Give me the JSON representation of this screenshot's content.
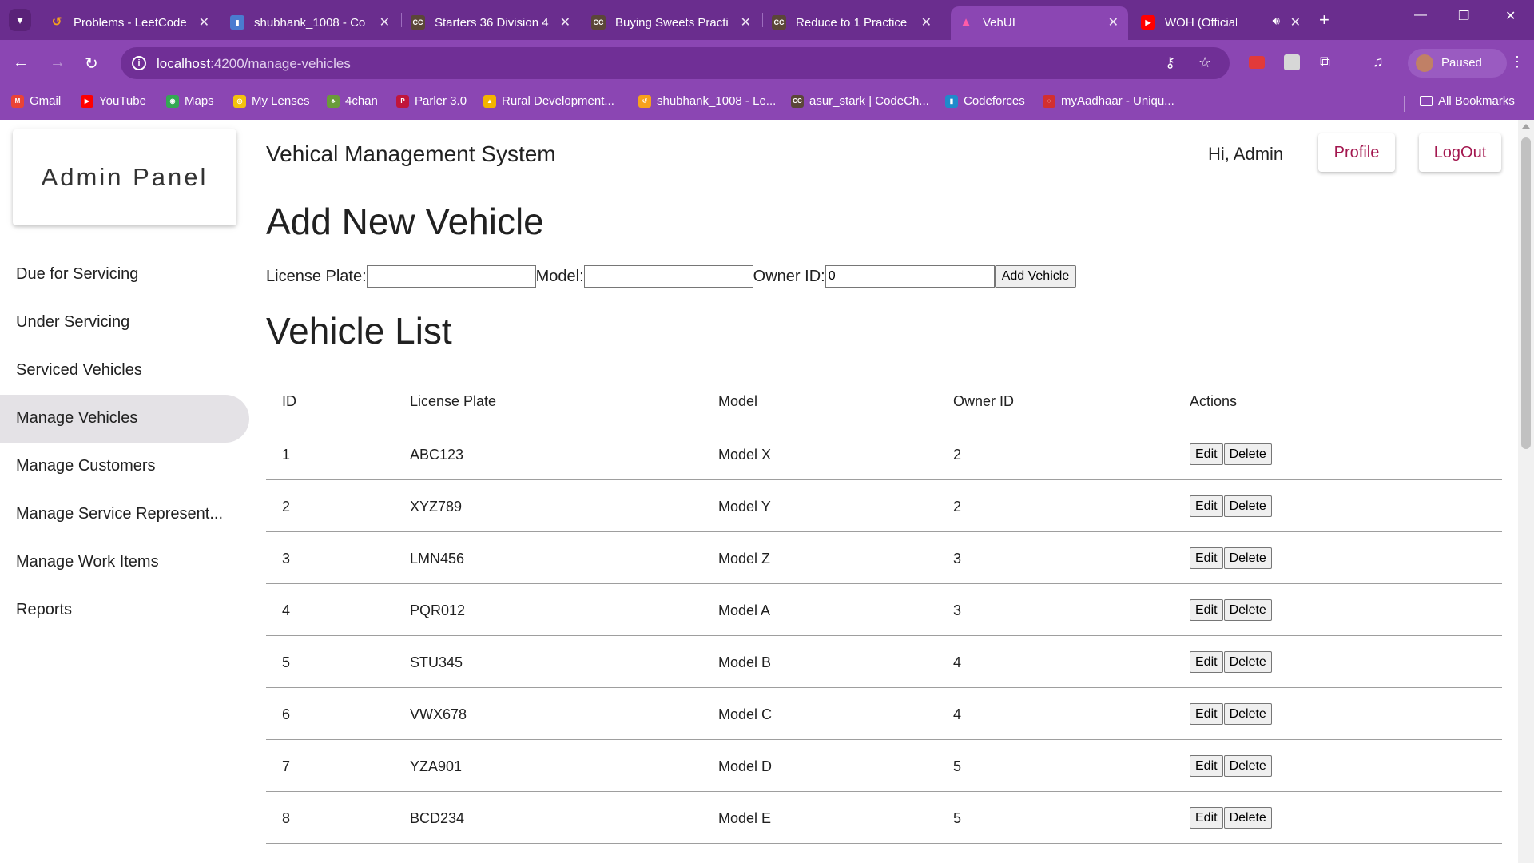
{
  "browser": {
    "tabs": [
      {
        "title": "Problems - LeetCode",
        "favicon": "leetcode-icon",
        "color": "#f7a21b"
      },
      {
        "title": "shubhank_1008 - Co",
        "favicon": "chart-icon",
        "color": "#4a7bd0"
      },
      {
        "title": "Starters 36 Division 4",
        "favicon": "codechef-icon",
        "color": "#5b4638"
      },
      {
        "title": "Buying Sweets Practi",
        "favicon": "codechef-icon",
        "color": "#5b4638"
      },
      {
        "title": "Reduce to 1 Practice",
        "favicon": "codechef-icon",
        "color": "#5b4638"
      },
      {
        "title": "VehUI",
        "favicon": "angular-icon",
        "color": "#d6247a"
      },
      {
        "title": "WOH (Official Vi",
        "favicon": "youtube-icon",
        "color": "#ff0000"
      }
    ],
    "address": {
      "host": "localhost",
      "path": ":4200/manage-vehicles"
    },
    "profile_status": "Paused",
    "bookmarks": [
      {
        "label": "Gmail",
        "icon": "gmail-icon",
        "color": "#ea4335"
      },
      {
        "label": "YouTube",
        "icon": "youtube-icon",
        "color": "#ff0000"
      },
      {
        "label": "Maps",
        "icon": "maps-icon",
        "color": "#34a853"
      },
      {
        "label": "My Lenses",
        "icon": "lens-icon",
        "color": "#f4c20d"
      },
      {
        "label": "4chan",
        "icon": "clover-icon",
        "color": "#6a9b3a"
      },
      {
        "label": "Parler 3.0",
        "icon": "parler-icon",
        "color": "#c0153b"
      },
      {
        "label": "Rural Development...",
        "icon": "drive-icon",
        "color": "#f4b400"
      },
      {
        "label": "shubhank_1008 - Le...",
        "icon": "leetcode-icon",
        "color": "#f7a21b"
      },
      {
        "label": "asur_stark | CodeCh...",
        "icon": "codechef-icon",
        "color": "#5b4638"
      },
      {
        "label": "Codeforces",
        "icon": "codeforces-icon",
        "color": "#1f8acb"
      },
      {
        "label": "myAadhaar - Uniqu...",
        "icon": "aadhaar-icon",
        "color": "#d32f2f"
      }
    ],
    "all_bookmarks": "All Bookmarks"
  },
  "sidebar": {
    "brand": "Admin Panel",
    "items": [
      {
        "label": "Due for Servicing",
        "active": false
      },
      {
        "label": "Under Servicing",
        "active": false
      },
      {
        "label": "Serviced Vehicles",
        "active": false
      },
      {
        "label": "Manage Vehicles",
        "active": true
      },
      {
        "label": "Manage Customers",
        "active": false
      },
      {
        "label": "Manage Service Represent...",
        "active": false
      },
      {
        "label": "Manage Work Items",
        "active": false
      },
      {
        "label": "Reports",
        "active": false
      }
    ]
  },
  "header": {
    "title": "Vehical Management System",
    "greeting": "Hi, Admin",
    "profile_label": "Profile",
    "logout_label": "LogOut"
  },
  "add_form": {
    "heading": "Add New Vehicle",
    "license_label": "License Plate:",
    "license_value": "",
    "model_label": "Model:",
    "model_value": "",
    "owner_label": "Owner ID:",
    "owner_value": "0",
    "submit_label": "Add Vehicle"
  },
  "vehicle_list": {
    "heading": "Vehicle List",
    "columns": [
      "ID",
      "License Plate",
      "Model",
      "Owner ID",
      "Actions"
    ],
    "edit_label": "Edit",
    "delete_label": "Delete",
    "rows": [
      {
        "id": "1",
        "plate": "ABC123",
        "model": "Model X",
        "owner": "2"
      },
      {
        "id": "2",
        "plate": "XYZ789",
        "model": "Model Y",
        "owner": "2"
      },
      {
        "id": "3",
        "plate": "LMN456",
        "model": "Model Z",
        "owner": "3"
      },
      {
        "id": "4",
        "plate": "PQR012",
        "model": "Model A",
        "owner": "3"
      },
      {
        "id": "5",
        "plate": "STU345",
        "model": "Model B",
        "owner": "4"
      },
      {
        "id": "6",
        "plate": "VWX678",
        "model": "Model C",
        "owner": "4"
      },
      {
        "id": "7",
        "plate": "YZA901",
        "model": "Model D",
        "owner": "5"
      },
      {
        "id": "8",
        "plate": "BCD234",
        "model": "Model E",
        "owner": "5"
      }
    ]
  }
}
